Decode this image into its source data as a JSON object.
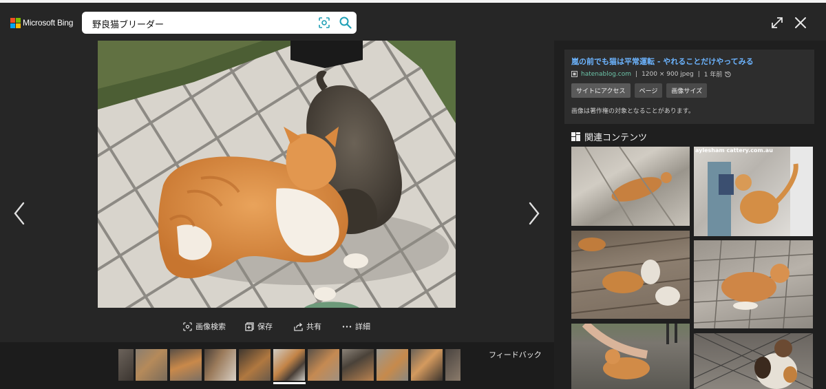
{
  "header": {
    "brand": "Microsoft Bing",
    "search_query": "野良猫ブリーダー",
    "logo_colors": [
      "#f25022",
      "#7fba00",
      "#00a4ef",
      "#ffb900"
    ],
    "accent": "#1e9fb5"
  },
  "actions": [
    {
      "icon": "visual-search-icon",
      "label": "画像検索"
    },
    {
      "icon": "save-icon",
      "label": "保存"
    },
    {
      "icon": "share-icon",
      "label": "共有"
    },
    {
      "icon": "more-icon",
      "label": "詳細"
    }
  ],
  "filmstrip": {
    "selected_index": 5,
    "feedback_label": "フィードバック"
  },
  "info": {
    "title": "嵐の前でも猫は平常運転 - やれることだけやってみる",
    "source": "hatenablog.com",
    "dimensions": "1200 × 900 jpeg",
    "age": "1 年前",
    "buttons": [
      "サイトにアクセス",
      "ページ",
      "画像サイズ"
    ],
    "copyright_note": "画像は著作権の対象となることがあります。"
  },
  "related": {
    "title": "関連コンテンツ",
    "watermark": "aylesham cattery.com.au"
  }
}
